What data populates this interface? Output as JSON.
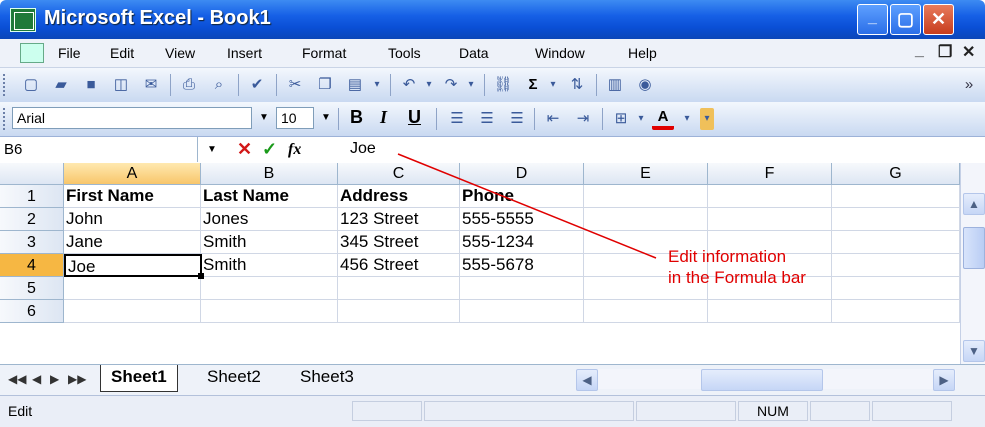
{
  "window": {
    "title": "Microsoft Excel - Book1",
    "minimize": "_",
    "restore": "▢",
    "close": "✕"
  },
  "menubar": {
    "items": [
      "File",
      "Edit",
      "View",
      "Insert",
      "Format",
      "Tools",
      "Data",
      "Window",
      "Help"
    ],
    "mdi_min": "_",
    "mdi_restore": "❐",
    "mdi_close": "✕"
  },
  "formatting": {
    "font": "Arial",
    "size": "10",
    "bold": "B",
    "italic": "I",
    "underline": "U"
  },
  "formula_bar": {
    "name_box": "B6",
    "cancel": "✕",
    "enter": "✓",
    "fx": "fx",
    "content": "Joe"
  },
  "columns": [
    "A",
    "B",
    "C",
    "D",
    "E",
    "F",
    "G"
  ],
  "rows": [
    "1",
    "2",
    "3",
    "4",
    "5",
    "6"
  ],
  "cells": [
    [
      "First Name",
      "Last Name",
      "Address",
      "Phone",
      "",
      "",
      ""
    ],
    [
      "John",
      "Jones",
      "123 Street",
      "555-5555",
      "",
      "",
      ""
    ],
    [
      "Jane",
      "Smith",
      "345 Street",
      "555-1234",
      "",
      "",
      ""
    ],
    [
      "Joe",
      "Smith",
      "456 Street",
      "555-5678",
      "",
      "",
      ""
    ],
    [
      "",
      "",
      "",
      "",
      "",
      "",
      ""
    ],
    [
      "",
      "",
      "",
      "",
      "",
      "",
      ""
    ]
  ],
  "sheets": [
    "Sheet1",
    "Sheet2",
    "Sheet3"
  ],
  "status": {
    "mode": "Edit",
    "num": "NUM"
  },
  "annotation": {
    "line1": "Edit information",
    "line2": "in the Formula bar"
  },
  "colors": {
    "title": "#0a4fd6",
    "annotation": "#e00000",
    "selected_header": "#f6b743"
  }
}
